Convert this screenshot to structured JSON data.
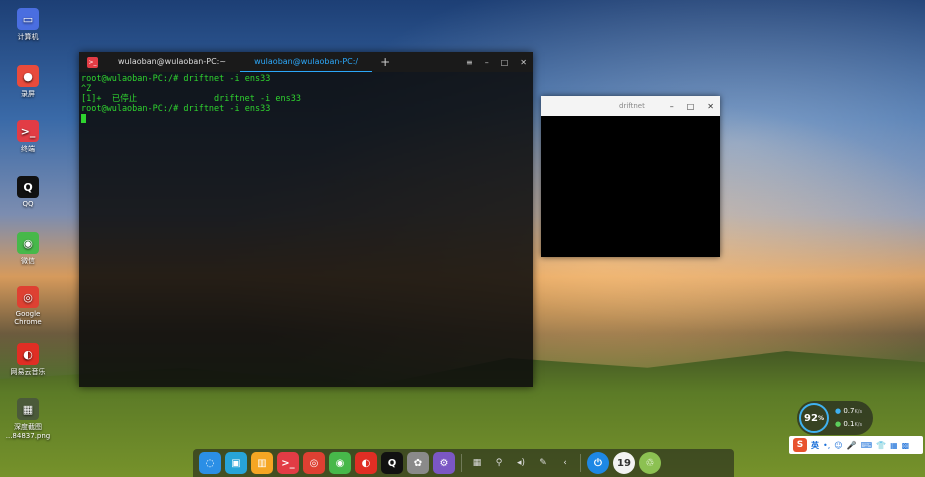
{
  "desktop": {
    "icons": [
      {
        "label": "计算机",
        "glyph": "▭",
        "color": "#4a6ee0",
        "icon": "computer-icon"
      },
      {
        "label": "录屏",
        "glyph": "●",
        "color": "#e84b3c",
        "icon": "screen-recorder-icon"
      },
      {
        "label": "终端",
        "glyph": ">_",
        "color": "#e23c45",
        "icon": "terminal-icon"
      },
      {
        "label": "QQ",
        "glyph": "Q",
        "color": "#111111",
        "icon": "qq-penguin-icon"
      },
      {
        "label": "微信",
        "glyph": "◉",
        "color": "#47b84a",
        "icon": "wechat-icon"
      },
      {
        "label": "Google Chrome",
        "glyph": "◎",
        "color": "#de4032",
        "icon": "chrome-icon"
      },
      {
        "label": "网易云音乐",
        "glyph": "◐",
        "color": "#e02e24",
        "icon": "netease-music-icon"
      },
      {
        "label": "深度截图 ...84837.png",
        "glyph": "▦",
        "color": "#4b5a3a",
        "icon": "screenshot-file-icon"
      }
    ]
  },
  "terminal": {
    "tabs": [
      {
        "label": "wulaoban@wulaoban-PC:~"
      },
      {
        "label": "wulaoban@wulaoban-PC:/"
      }
    ],
    "add_tab": "+",
    "controls": {
      "menu": "≡",
      "minimize": "–",
      "maximize": "□",
      "close": "✕"
    },
    "lines": [
      "root@wulaoban-PC:/# driftnet -i ens33",
      "^Z",
      "[1]+  已停止               driftnet -i ens33",
      "root@wulaoban-PC:/# driftnet -i ens33"
    ]
  },
  "driftnet": {
    "title": "driftnet",
    "controls": {
      "minimize": "–",
      "maximize": "□",
      "close": "✕"
    }
  },
  "dock": {
    "apps": [
      {
        "glyph": "◌",
        "color": "#2b8fe6",
        "icon": "launcher-icon"
      },
      {
        "glyph": "▣",
        "color": "#27a4d8",
        "icon": "app-store-icon"
      },
      {
        "glyph": "▥",
        "color": "#f5a623",
        "icon": "file-manager-icon"
      },
      {
        "glyph": ">_",
        "color": "#e23c45",
        "icon": "terminal-icon"
      },
      {
        "glyph": "◎",
        "color": "#de4032",
        "icon": "chrome-icon"
      },
      {
        "glyph": "◉",
        "color": "#47b84a",
        "icon": "wechat-icon"
      },
      {
        "glyph": "◐",
        "color": "#e02e24",
        "icon": "netease-music-icon"
      },
      {
        "glyph": "Q",
        "color": "#111111",
        "icon": "qq-penguin-icon"
      },
      {
        "glyph": "✿",
        "color": "#8a8a8a",
        "icon": "settings-icon"
      },
      {
        "glyph": "⚙",
        "color": "#7b57c4",
        "icon": "control-center-icon"
      }
    ],
    "tray": [
      {
        "glyph": "▦",
        "icon": "keyboard-icon"
      },
      {
        "glyph": "⚲",
        "icon": "location-icon"
      },
      {
        "glyph": "◂)",
        "icon": "volume-icon"
      },
      {
        "glyph": "✎",
        "icon": "pen-icon"
      },
      {
        "glyph": "‹",
        "icon": "chevron-left-icon"
      }
    ],
    "right": [
      {
        "glyph": "⏻",
        "color": "#1e88e5",
        "icon": "power-icon"
      },
      {
        "glyph": "19",
        "color": "#f3f3f3",
        "icon": "clock-icon"
      },
      {
        "glyph": "♲",
        "color": "#8cc152",
        "icon": "trash-icon"
      }
    ]
  },
  "net_monitor": {
    "percent": "92",
    "unit": "%",
    "upload": "0.7",
    "upload_unit": "K/s",
    "download": "0.1",
    "download_unit": "K/s"
  },
  "ime": {
    "logo": "S",
    "mode": "英",
    "icons": [
      "•,",
      "☺",
      "🎤",
      "⌨",
      "👕",
      "▦",
      "▩"
    ]
  }
}
